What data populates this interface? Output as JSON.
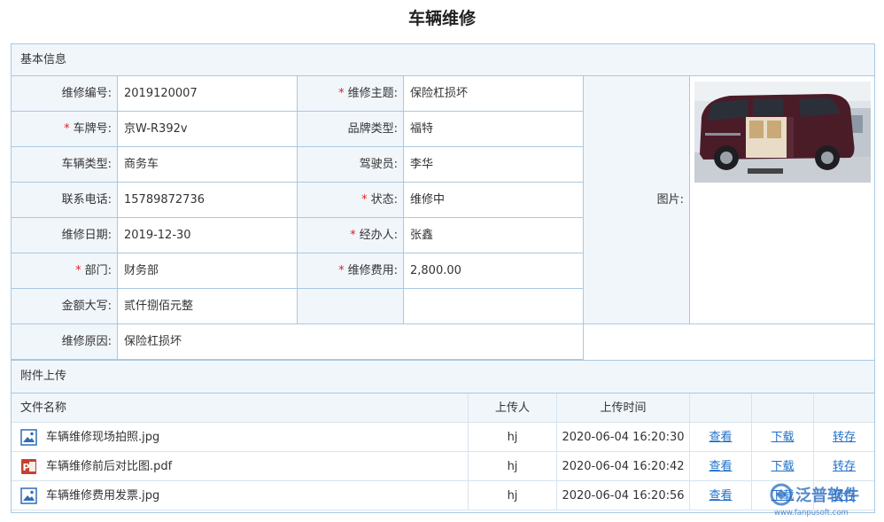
{
  "page_title": "车辆维修",
  "basic_section": "基本信息",
  "fields": {
    "repair_no": {
      "label": "维修编号:",
      "value": "2019120007"
    },
    "repair_subject": {
      "label": "维修主题:",
      "value": "保险杠损坏"
    },
    "plate": {
      "label": "车牌号:",
      "value": "京W-R392v"
    },
    "brand": {
      "label": "品牌类型:",
      "value": "福特"
    },
    "vehicle_type": {
      "label": "车辆类型:",
      "value": "商务车"
    },
    "driver": {
      "label": "驾驶员:",
      "value": "李华"
    },
    "phone": {
      "label": "联系电话:",
      "value": "15789872736"
    },
    "status": {
      "label": "状态:",
      "value": "维修中"
    },
    "repair_date": {
      "label": "维修日期:",
      "value": "2019-12-30"
    },
    "handler": {
      "label": "经办人:",
      "value": "张鑫"
    },
    "dept": {
      "label": "部门:",
      "value": "财务部"
    },
    "cost": {
      "label": "维修费用:",
      "value": "2,800.00"
    },
    "amount_cn": {
      "label": "金额大写:",
      "value": "贰仟捌佰元整"
    },
    "reason": {
      "label": "维修原因:",
      "value": "保险杠损坏"
    },
    "picture": {
      "label": "图片:"
    }
  },
  "required_mark": "*",
  "attach_section": "附件上传",
  "table": {
    "headers": {
      "name": "文件名称",
      "uploader": "上传人",
      "time": "上传时间"
    },
    "rows": [
      {
        "icon": "image-file-icon",
        "name": "车辆维修现场拍照.jpg",
        "uploader": "hj",
        "time": "2020-06-04 16:20:30",
        "view": "查看",
        "download": "下载",
        "save": "转存"
      },
      {
        "icon": "pdf-file-icon",
        "name": "车辆维修前后对比图.pdf",
        "uploader": "hj",
        "time": "2020-06-04 16:20:42",
        "view": "查看",
        "download": "下载",
        "save": "转存"
      },
      {
        "icon": "image-file-icon",
        "name": "车辆维修费用发票.jpg",
        "uploader": "hj",
        "time": "2020-06-04 16:20:56",
        "view": "查看",
        "download": "下载",
        "save": "转存"
      }
    ]
  },
  "watermark": {
    "brand": "泛普软件",
    "url": "www.fanpusoft.com"
  },
  "colors": {
    "border": "#a9c8e2",
    "label_bg": "#f1f6fb",
    "link": "#1f6fc8",
    "required": "#e02020"
  }
}
